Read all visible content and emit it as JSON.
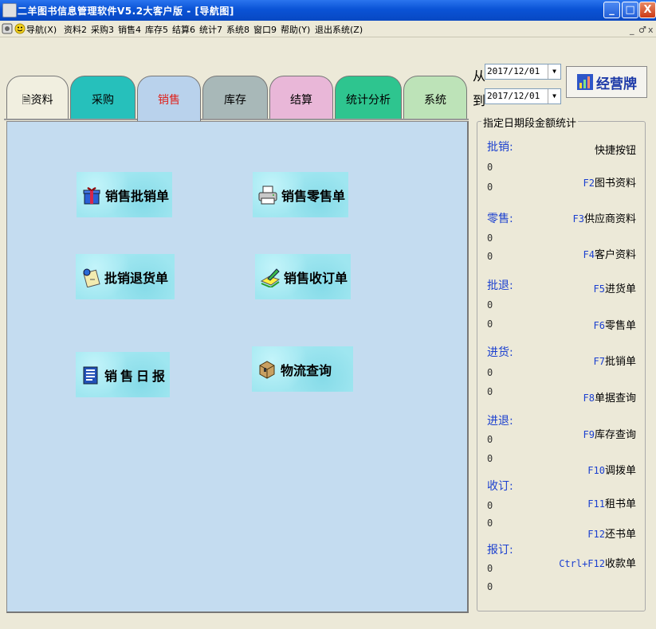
{
  "window": {
    "title": "二羊图书信息管理软件V5.2大客户版 - [导航图]",
    "min": "_",
    "max": "□",
    "close": "X"
  },
  "menu": [
    "导航(X)",
    "资料2",
    "采购3",
    "销售4",
    "库存5",
    "结算6",
    "统计7",
    "系统8",
    "窗口9",
    "帮助(Y)",
    "退出系统(Z)"
  ],
  "mdi": {
    "min": "_",
    "restore": "♂",
    "close": "x"
  },
  "tabs": [
    {
      "label": "资料",
      "color": "#f1efe0"
    },
    {
      "label": "采购",
      "color": "#26c0bb"
    },
    {
      "label": "销售",
      "color": "#b9d2ec",
      "active": true
    },
    {
      "label": "库存",
      "color": "#a8b8b8"
    },
    {
      "label": "结算",
      "color": "#e9b7d8"
    },
    {
      "label": "统计分析",
      "color": "#2ec58f"
    },
    {
      "label": "系统",
      "color": "#bde3b8"
    }
  ],
  "actions": {
    "wholesale_order": "销售批销单",
    "retail_order": "销售零售单",
    "wholesale_return": "批销退货单",
    "sales_subscription": "销售收订单",
    "daily_report": "销售日报",
    "logistics": "物流查询"
  },
  "date_range": {
    "from_label": "从",
    "from": "2017/12/01",
    "to_label": "到",
    "to": "2017/12/01"
  },
  "business_button": "经营牌",
  "stats": {
    "legend": "指定日期段金额统计",
    "items": [
      {
        "label": "批销:",
        "v1": "0",
        "v2": "0"
      },
      {
        "label": "零售:",
        "v1": "0",
        "v2": "0"
      },
      {
        "label": "批退:",
        "v1": "0",
        "v2": "0"
      },
      {
        "label": "进货:",
        "v1": "0",
        "v2": "0"
      },
      {
        "label": "进退:",
        "v1": "0",
        "v2": "0"
      },
      {
        "label": "收订:",
        "v1": "0",
        "v2": "0"
      },
      {
        "label": "报订:",
        "v1": "0",
        "v2": "0"
      }
    ]
  },
  "shortcuts": {
    "header": "快捷按钮",
    "items": [
      {
        "key": "F2",
        "label": "图书资料"
      },
      {
        "key": "F3",
        "label": "供应商资料"
      },
      {
        "key": "F4",
        "label": "客户资料"
      },
      {
        "key": "F5",
        "label": "进货单"
      },
      {
        "key": "F6",
        "label": "零售单"
      },
      {
        "key": "F7",
        "label": "批销单"
      },
      {
        "key": "F8",
        "label": "单据查询"
      },
      {
        "key": "F9",
        "label": "库存查询"
      },
      {
        "key": "F10",
        "label": "调拨单"
      },
      {
        "key": "F11",
        "label": "租书单"
      },
      {
        "key": "F12",
        "label": "还书单"
      },
      {
        "key": "Ctrl+F12",
        "label": "收款单"
      }
    ]
  }
}
